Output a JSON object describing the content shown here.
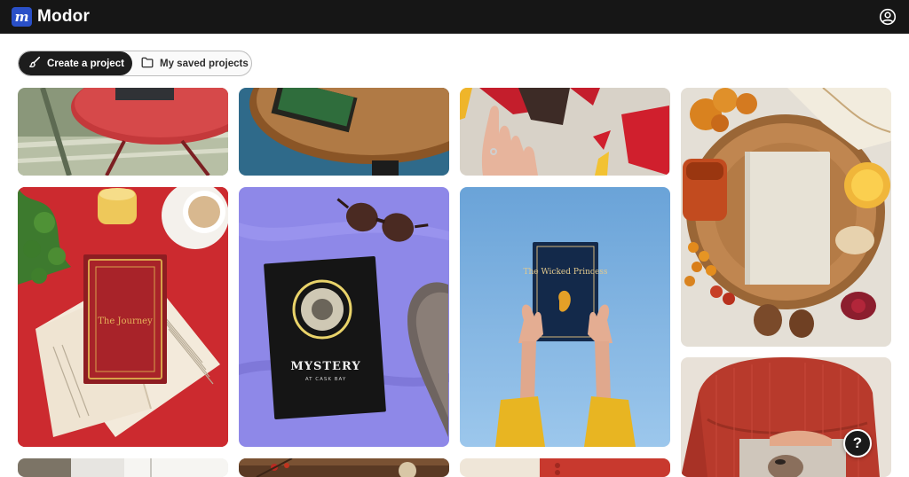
{
  "app": {
    "name": "Modor",
    "logo_letter": "m"
  },
  "header": {
    "account_icon": "user-circle-icon"
  },
  "tabs": [
    {
      "label": "Create a project",
      "icon": "brush-icon",
      "active": true
    },
    {
      "label": "My saved projects",
      "icon": "folder-icon",
      "active": false
    }
  ],
  "gallery": {
    "tiles": [
      {
        "id": "garden-table-book"
      },
      {
        "id": "wood-table-green-book"
      },
      {
        "id": "hand-red-paper"
      },
      {
        "id": "autumn-blank-book"
      },
      {
        "id": "red-ornate-book",
        "cover_title": "The Journey"
      },
      {
        "id": "mystery-book-purple",
        "cover_title": "MYSTERY",
        "cover_subtitle": "AT CASK BAY"
      },
      {
        "id": "wicked-princess-sky",
        "cover_title": "The Wicked Princess"
      },
      {
        "id": "red-sweater-book"
      },
      {
        "id": "window-scene"
      },
      {
        "id": "berries-table"
      },
      {
        "id": "cream-red-scene"
      }
    ]
  },
  "help": {
    "label": "?"
  },
  "colors": {
    "topbar": "#161616",
    "brand": "#2a50c8",
    "active_tab": "#1d1d1d"
  }
}
